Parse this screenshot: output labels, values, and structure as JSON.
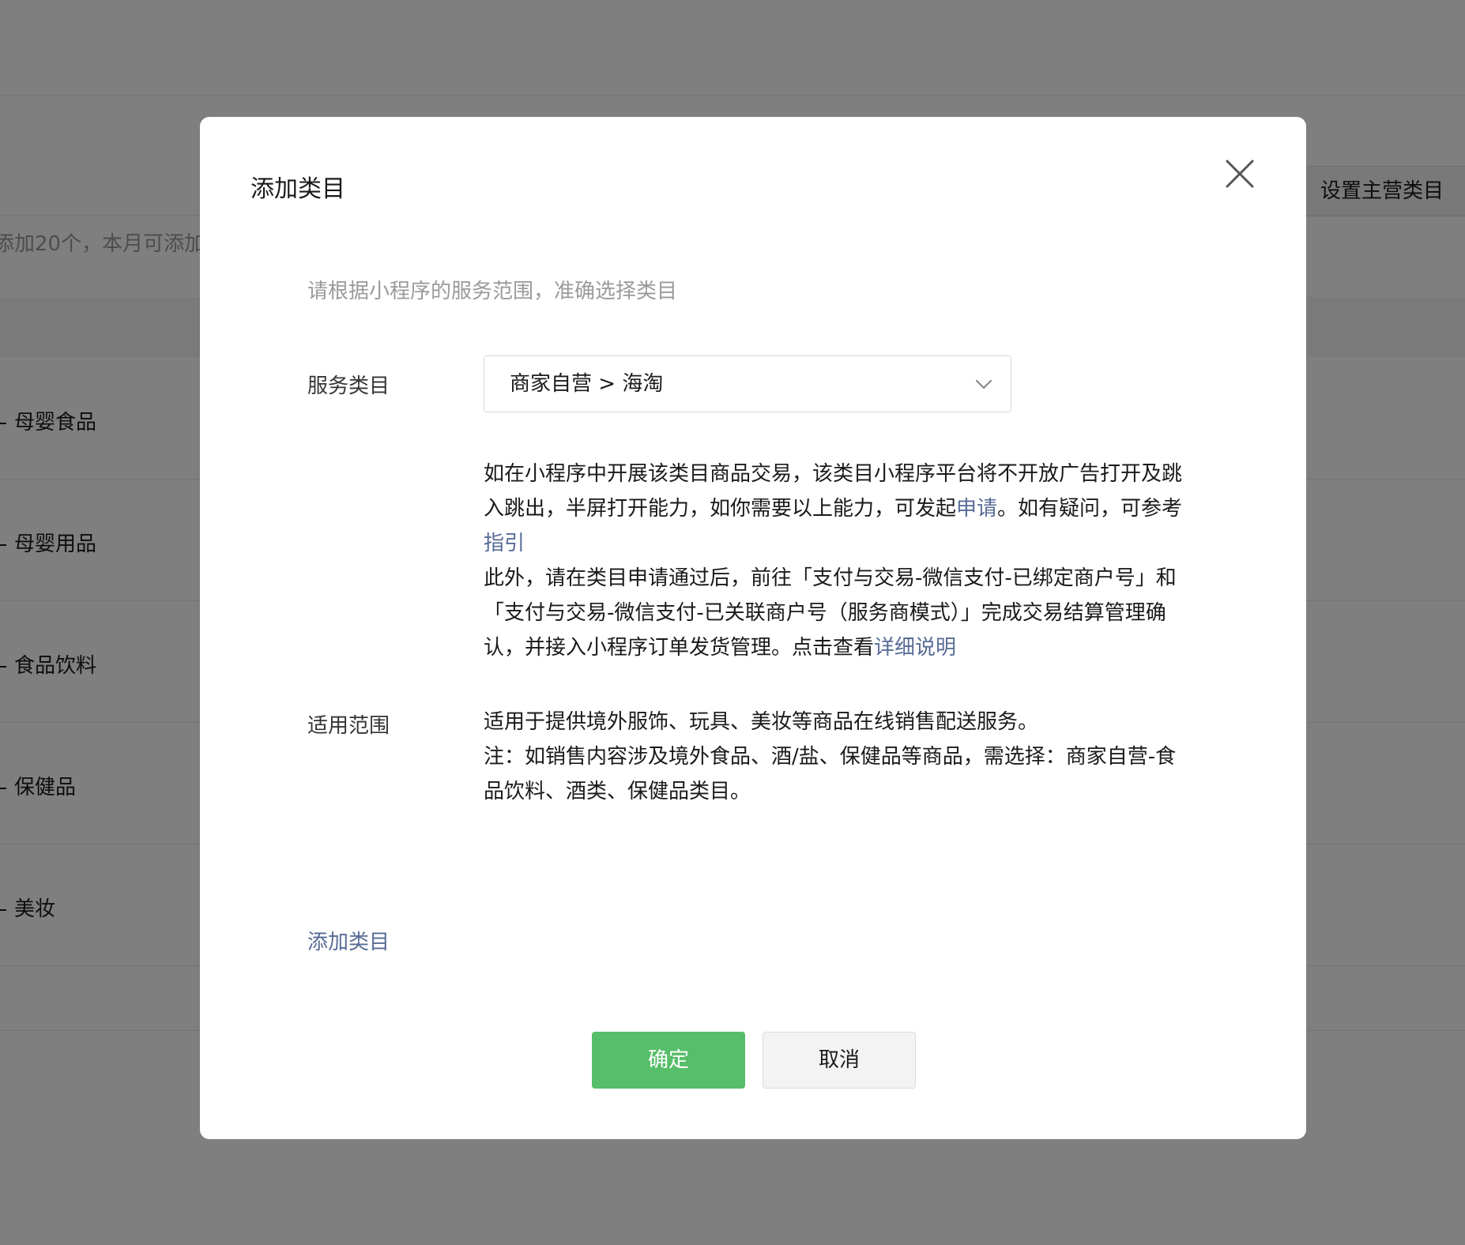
{
  "background": {
    "main_category_button": "设置主营类目",
    "quota_text": "添加20个，本月可添加",
    "rows": [
      "母婴食品",
      "母婴用品",
      "食品饮料",
      "保健品",
      "美妆"
    ]
  },
  "modal": {
    "title": "添加类目",
    "hint": "请根据小程序的服务范围，准确选择类目",
    "service_label": "服务类目",
    "service_value": "商家自营 > 海淘",
    "desc": {
      "part1": "如在小程序中开展该类目商品交易，该类目小程序平台将不开放广告打开及跳入跳出，半屏打开能力，如你需要以上能力，可发起",
      "apply_link": "申请",
      "part2": "。如有疑问，可参考",
      "guide_link": "指引",
      "part3": "此外，请在类目申请通过后，前往「支付与交易-微信支付-已绑定商户号」和「支付与交易-微信支付-已关联商户号（服务商模式）」完成交易结算管理确认，并接入小程序订单发货管理。点击查看",
      "detail_link": "详细说明"
    },
    "scope_label": "适用范围",
    "scope_line1": "适用于提供境外服饰、玩具、美妆等商品在线销售配送服务。",
    "scope_line2": "注：如销售内容涉及境外食品、酒/盐、保健品等商品，需选择：商家自营-食品饮料、酒类、保健品类目。",
    "add_category_link": "添加类目",
    "confirm_button": "确定",
    "cancel_button": "取消"
  },
  "colors": {
    "primary": "#57be6a",
    "link": "#576b95",
    "overlay": "rgba(0,0,0,0.5)"
  },
  "icons": {
    "close": "close-icon",
    "dropdown": "chevron-down-icon"
  }
}
